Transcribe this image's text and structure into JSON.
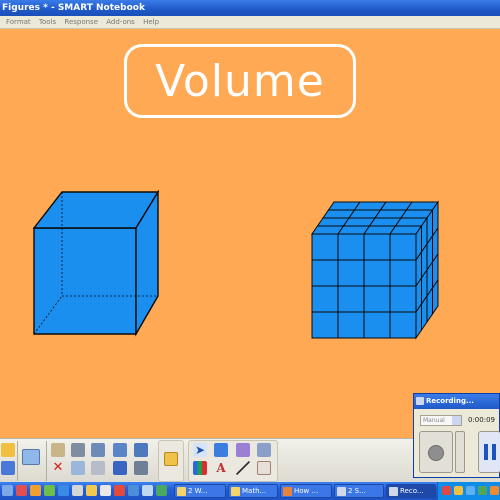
{
  "window": {
    "title": "Figures * - SMART Notebook"
  },
  "menu": {
    "items": [
      "Format",
      "Tools",
      "Response",
      "Add-ons",
      "Help"
    ]
  },
  "slide": {
    "title": "Volume"
  },
  "colors": {
    "canvas": "#ffa955",
    "cube_fill": "#1a8ff0",
    "cube_stroke": "#0a0a0a"
  },
  "taskbar": {
    "tasks": [
      "2 W...",
      "Math...",
      "How ...",
      "2 S...",
      "Reco..."
    ]
  },
  "recorder": {
    "title": "Recording...",
    "mode_value": "Manual",
    "time": "0:00:09"
  }
}
